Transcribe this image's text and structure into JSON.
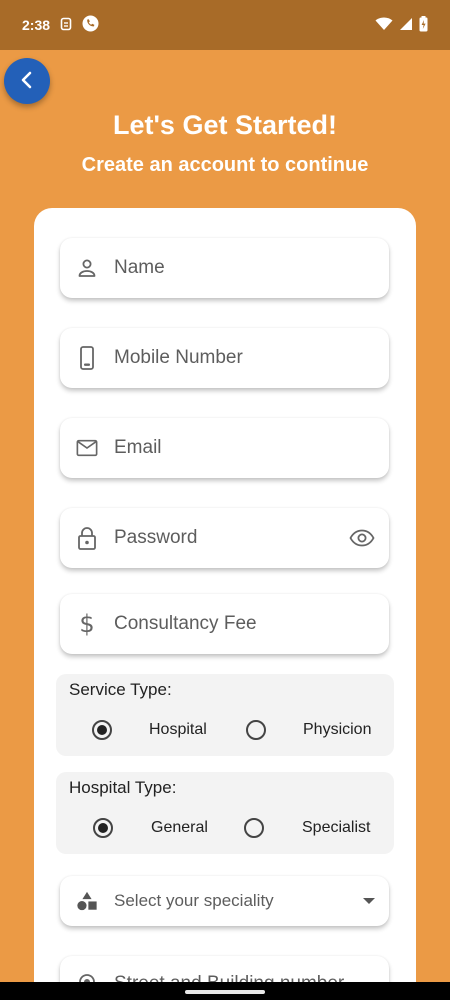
{
  "status_bar": {
    "time": "2:38",
    "icons": [
      "sim-icon",
      "phone-call-icon",
      "wifi-icon",
      "signal-icon",
      "battery-icon"
    ]
  },
  "header": {
    "title": "Let's Get Started!",
    "subtitle": "Create an account to continue"
  },
  "form": {
    "name": {
      "placeholder": "Name",
      "icon": "person-icon"
    },
    "mobile": {
      "placeholder": "Mobile Number",
      "icon": "phone-icon"
    },
    "email": {
      "placeholder": "Email",
      "icon": "mail-icon"
    },
    "password": {
      "placeholder": "Password",
      "icon": "lock-icon",
      "trailing_icon": "eye-icon"
    },
    "fee": {
      "placeholder": "Consultancy Fee",
      "icon": "dollar-icon"
    },
    "service_type": {
      "label": "Service Type:",
      "options": [
        "Hospital",
        "Physicion"
      ],
      "selected": "Hospital"
    },
    "hospital_type": {
      "label": "Hospital Type:",
      "options": [
        "General",
        "Specialist"
      ],
      "selected": "General"
    },
    "speciality": {
      "placeholder": "Select your speciality",
      "icon": "category-icon"
    },
    "street": {
      "placeholder": "Street and Building number",
      "icon": "location-icon"
    }
  },
  "colors": {
    "background": "#EB9A45",
    "status_bar": "#A86B28",
    "back_button": "#2360B8",
    "card": "#FFFFFF"
  }
}
